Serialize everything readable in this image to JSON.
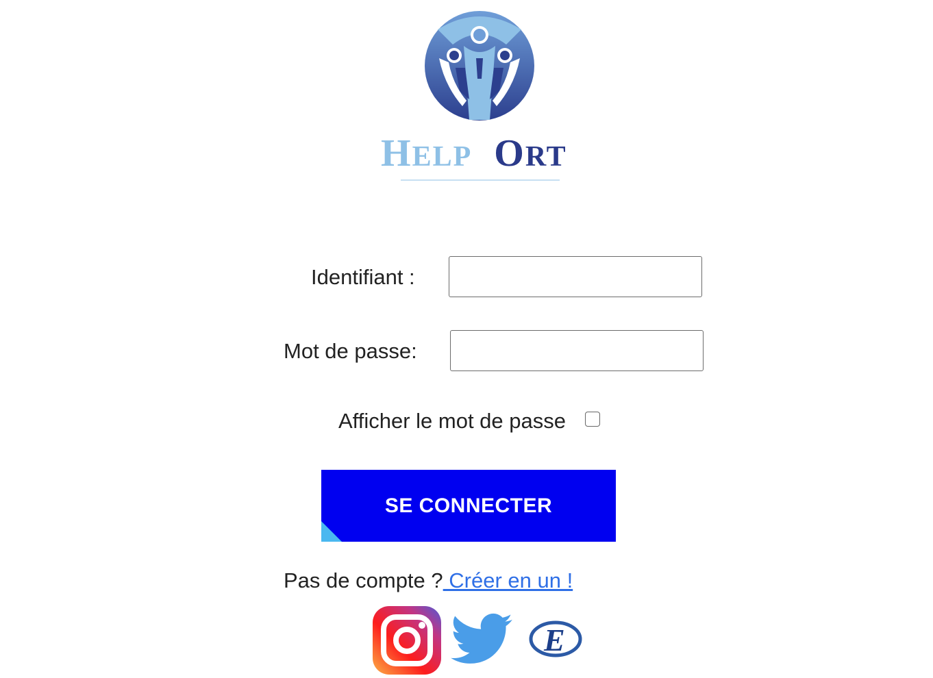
{
  "brand": {
    "name_part1_initial": "H",
    "name_part1_rest": "ELP",
    "name_part2_initial": "O",
    "name_part2_rest": "RT",
    "primary_color": "#2a3a8a",
    "light_color": "#8ec0e6"
  },
  "form": {
    "username_label": "Identifiant :",
    "username_value": "",
    "password_label": "Mot de passe:",
    "password_value": "",
    "show_password_label": "Afficher le mot de passe",
    "show_password_checked": false
  },
  "login_button": {
    "label": "SE CONNECTER",
    "color": "#0000f0"
  },
  "signup": {
    "prompt": "Pas de compte ?",
    "link_text": " Créer en un !"
  },
  "social": [
    {
      "icon": "instagram-icon"
    },
    {
      "icon": "twitter-icon"
    },
    {
      "icon": "ecoledirecte-icon"
    }
  ]
}
